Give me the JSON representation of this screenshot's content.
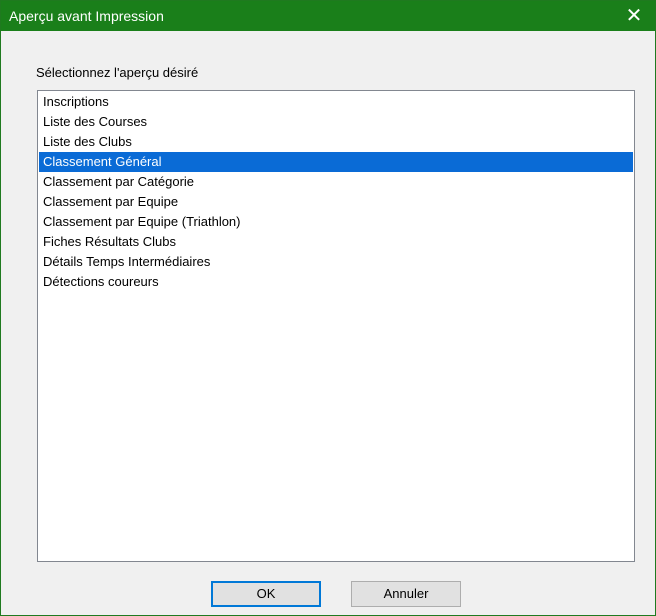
{
  "window": {
    "title": "Aperçu avant Impression",
    "close_glyph": "✕"
  },
  "prompt_label": "Sélectionnez l'aperçu désiré",
  "list": {
    "items": [
      "Inscriptions",
      "Liste des Courses",
      "Liste des Clubs",
      "Classement Général",
      "Classement par Catégorie",
      "Classement par Equipe",
      "Classement par Equipe (Triathlon)",
      "Fiches Résultats Clubs",
      "Détails Temps Intermédiaires",
      "Détections coureurs"
    ],
    "selected_index": 3,
    "selected_value": "Classement Général"
  },
  "buttons": {
    "ok": "OK",
    "cancel": "Annuler"
  },
  "colors": {
    "titlebar": "#1a7f1a",
    "selection": "#0a6bd6"
  },
  "icons": {
    "close": "close-icon"
  }
}
